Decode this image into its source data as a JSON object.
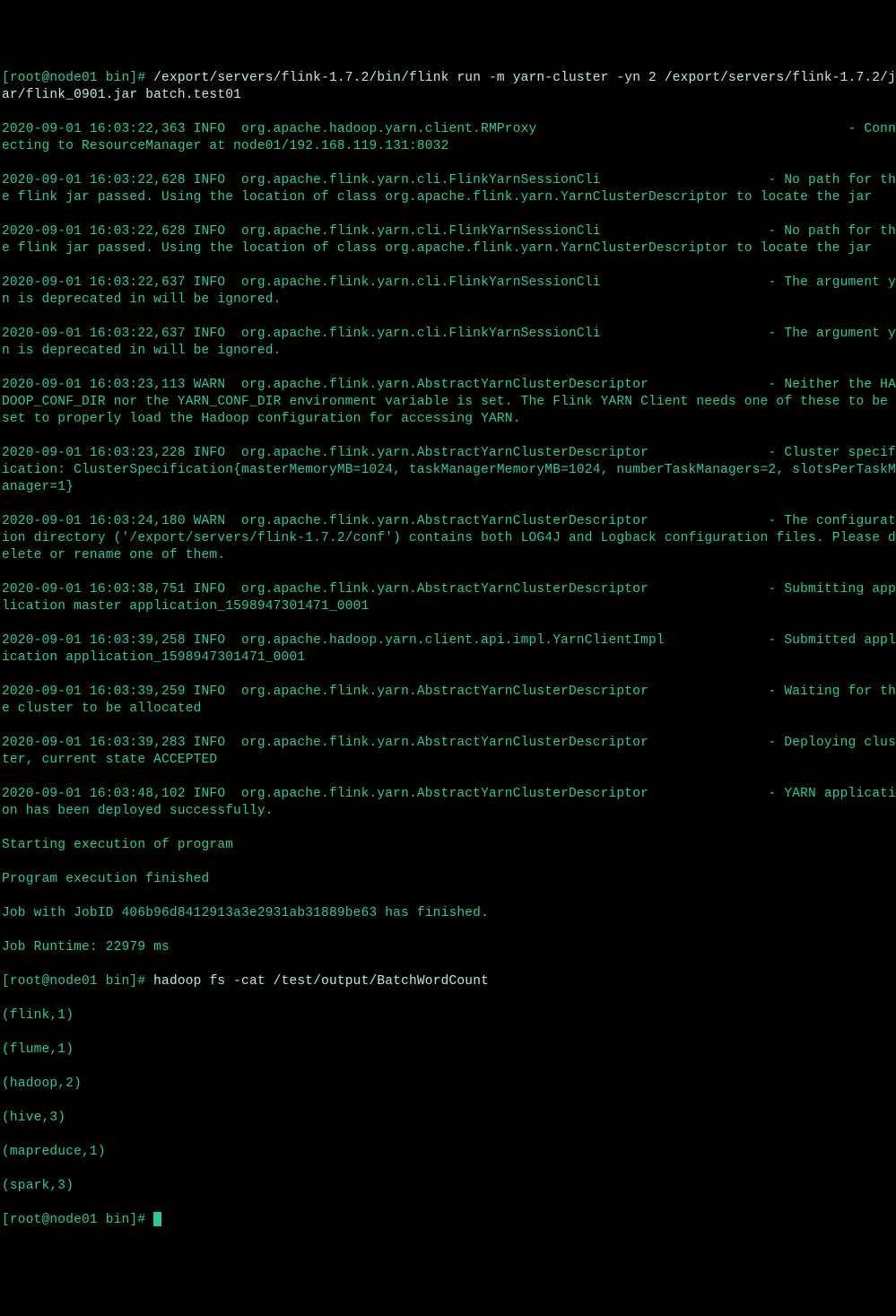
{
  "prompt1": "[root@node01 bin]# ",
  "cmd1": "/export/servers/flink-1.7.2/bin/flink run -m yarn-cluster -yn 2 /export/servers/flink-1.7.2/jar/flink_0901.jar batch.test01",
  "log_lines": [
    {
      "ts": "2020-09-01 16:03:22,363",
      "lvl": "INFO",
      "cls": "org.apache.hadoop.yarn.client.RMProxy",
      "pad": "                                       ",
      "msg": "- Connecting to ResourceManager at node01/192.168.119.131:8032"
    },
    {
      "ts": "2020-09-01 16:03:22,628",
      "lvl": "INFO",
      "cls": "org.apache.flink.yarn.cli.FlinkYarnSessionCli",
      "pad": "                     ",
      "msg": "- No path for the flink jar passed. Using the location of class org.apache.flink.yarn.YarnClusterDescriptor to locate the jar"
    },
    {
      "ts": "2020-09-01 16:03:22,628",
      "lvl": "INFO",
      "cls": "org.apache.flink.yarn.cli.FlinkYarnSessionCli",
      "pad": "                     ",
      "msg": "- No path for the flink jar passed. Using the location of class org.apache.flink.yarn.YarnClusterDescriptor to locate the jar"
    },
    {
      "ts": "2020-09-01 16:03:22,637",
      "lvl": "INFO",
      "cls": "org.apache.flink.yarn.cli.FlinkYarnSessionCli",
      "pad": "                     ",
      "msg": "- The argument yn is deprecated in will be ignored."
    },
    {
      "ts": "2020-09-01 16:03:22,637",
      "lvl": "INFO",
      "cls": "org.apache.flink.yarn.cli.FlinkYarnSessionCli",
      "pad": "                     ",
      "msg": "- The argument yn is deprecated in will be ignored."
    },
    {
      "ts": "2020-09-01 16:03:23,113",
      "lvl": "WARN",
      "cls": "org.apache.flink.yarn.AbstractYarnClusterDescriptor",
      "pad": "               ",
      "msg": "- Neither the HADOOP_CONF_DIR nor the YARN_CONF_DIR environment variable is set. The Flink YARN Client needs one of these to be set to properly load the Hadoop configuration for accessing YARN."
    },
    {
      "ts": "2020-09-01 16:03:23,228",
      "lvl": "INFO",
      "cls": "org.apache.flink.yarn.AbstractYarnClusterDescriptor",
      "pad": "               ",
      "msg": "- Cluster specification: ClusterSpecification{masterMemoryMB=1024, taskManagerMemoryMB=1024, numberTaskManagers=2, slotsPerTaskManager=1}"
    },
    {
      "ts": "2020-09-01 16:03:24,180",
      "lvl": "WARN",
      "cls": "org.apache.flink.yarn.AbstractYarnClusterDescriptor",
      "pad": "               ",
      "msg": "- The configuration directory ('/export/servers/flink-1.7.2/conf') contains both LOG4J and Logback configuration files. Please delete or rename one of them."
    },
    {
      "ts": "2020-09-01 16:03:38,751",
      "lvl": "INFO",
      "cls": "org.apache.flink.yarn.AbstractYarnClusterDescriptor",
      "pad": "               ",
      "msg": "- Submitting application master application_1598947301471_0001"
    },
    {
      "ts": "2020-09-01 16:03:39,258",
      "lvl": "INFO",
      "cls": "org.apache.hadoop.yarn.client.api.impl.YarnClientImpl",
      "pad": "             ",
      "msg": "- Submitted application application_1598947301471_0001"
    },
    {
      "ts": "2020-09-01 16:03:39,259",
      "lvl": "INFO",
      "cls": "org.apache.flink.yarn.AbstractYarnClusterDescriptor",
      "pad": "               ",
      "msg": "- Waiting for the cluster to be allocated"
    },
    {
      "ts": "2020-09-01 16:03:39,283",
      "lvl": "INFO",
      "cls": "org.apache.flink.yarn.AbstractYarnClusterDescriptor",
      "pad": "               ",
      "msg": "- Deploying cluster, current state ACCEPTED"
    },
    {
      "ts": "2020-09-01 16:03:48,102",
      "lvl": "INFO",
      "cls": "org.apache.flink.yarn.AbstractYarnClusterDescriptor",
      "pad": "               ",
      "msg": "- YARN application has been deployed successfully."
    }
  ],
  "exec_start": "Starting execution of program",
  "exec_finish": "Program execution finished",
  "job_finished": "Job with JobID 406b96d8412913a3e2931ab31889be63 has finished.",
  "job_runtime": "Job Runtime: 22979 ms",
  "prompt2": "[root@node01 bin]# ",
  "cmd2": "hadoop fs -cat /test/output/BatchWordCount",
  "output_lines": [
    "(flink,1)",
    "(flume,1)",
    "(hadoop,2)",
    "(hive,3)",
    "(mapreduce,1)",
    "(spark,3)"
  ],
  "prompt3": "[root@node01 bin]# "
}
